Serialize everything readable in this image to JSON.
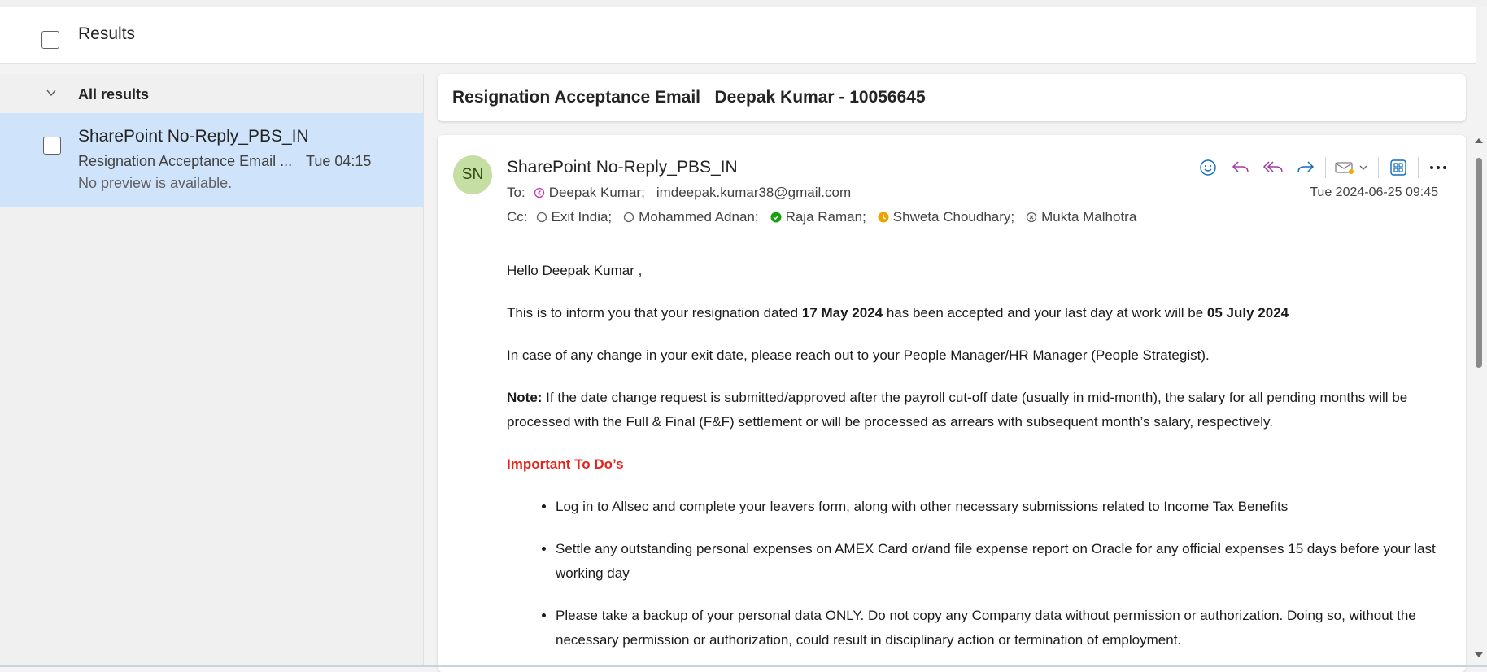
{
  "header": {
    "title": "Results"
  },
  "list": {
    "group_label": "All results",
    "items": [
      {
        "sender": "SharePoint No-Reply_PBS_IN",
        "subject": "Resignation Acceptance Email ...",
        "time": "Tue 04:15",
        "preview": "No preview is available."
      }
    ]
  },
  "message": {
    "subject": "Resignation Acceptance Email   Deepak Kumar - 10056645",
    "avatar_initials": "SN",
    "sender": "SharePoint No-Reply_PBS_IN",
    "date": "Tue 2024-06-25 09:45",
    "to_label": "To:",
    "to": [
      {
        "name": "Deepak Kumar;",
        "status": "presence-icon"
      },
      {
        "name": "imdeepak.kumar38@gmail.com",
        "status": ""
      }
    ],
    "cc_label": "Cc:",
    "cc": [
      {
        "name": "Exit India;",
        "status": "offline"
      },
      {
        "name": "Mohammed Adnan;",
        "status": "offline"
      },
      {
        "name": "Raja Raman;",
        "status": "available"
      },
      {
        "name": "Shweta Choudhary;",
        "status": "away"
      },
      {
        "name": "Mukta Malhotra",
        "status": "do-not-disturb"
      }
    ],
    "body": {
      "greeting": "Hello Deepak Kumar ,",
      "p1_a": "This is to inform you that your resignation dated ",
      "p1_b": "17 May 2024",
      "p1_c": " has been accepted and your last day at work will be ",
      "p1_d": "05 July 2024",
      "p2": "In case of any change in your exit date, please reach out to your People Manager/HR Manager (People Strategist).",
      "note_label": "Note:",
      "note_text": " If the date change request is submitted/approved after the payroll cut-off date (usually in mid-month), the salary for all pending months will be processed with the Full & Final (F&F) settlement or will be processed as arrears with subsequent month’s salary, respectively.",
      "todo_heading": "Important To Do’s",
      "todos": [
        "Log in to Allsec and complete your leavers form, along with other necessary submissions related to Income Tax Benefits",
        "Settle any outstanding personal expenses on AMEX Card or/and file expense report on Oracle for any official expenses 15 days before your last working day",
        "Please take a backup of your personal data ONLY. Do not copy any Company data without permission or authorization. Doing so, without the necessary permission or authorization, could result in disciplinary action or termination of employment."
      ]
    }
  },
  "colors": {
    "selected_item_bg": "#cfe4fa",
    "accent": "#0f6cbd",
    "reply_all_purple": "#a33ca1",
    "important_red": "#e8221b",
    "avatar_bg": "#c5dfa2"
  },
  "icons": [
    "checkbox",
    "chevron-down-icon",
    "emoji-icon",
    "reply-icon",
    "reply-all-icon",
    "forward-icon",
    "more-actions-icon",
    "apps-icon",
    "more-icon"
  ]
}
